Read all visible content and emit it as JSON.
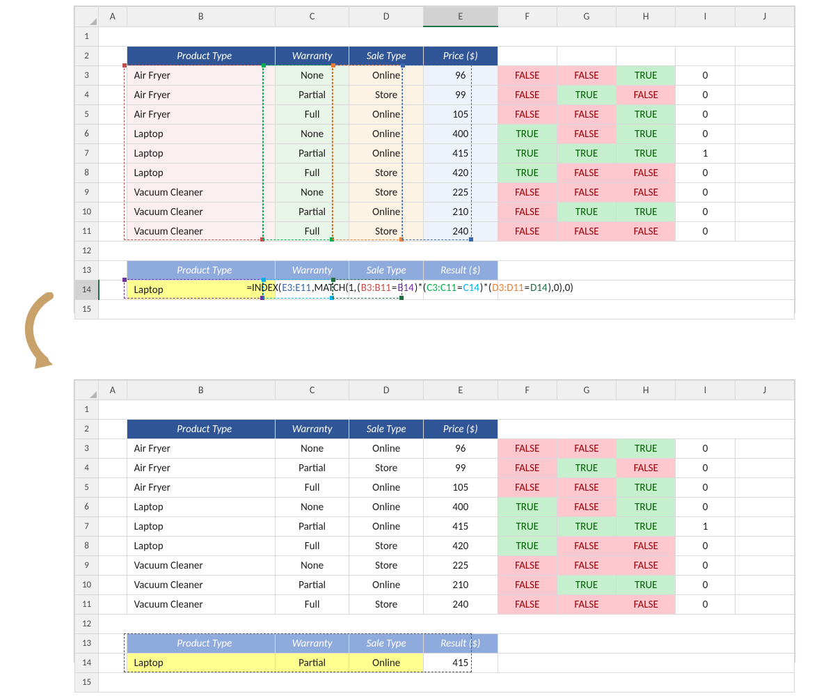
{
  "columns": [
    "A",
    "B",
    "C",
    "D",
    "E",
    "F",
    "G",
    "H",
    "I",
    "J"
  ],
  "rows": [
    1,
    2,
    3,
    4,
    5,
    6,
    7,
    8,
    9,
    10,
    11,
    12,
    13,
    14,
    15
  ],
  "headers_main": {
    "product_type": "Product Type",
    "warranty": "Warranty",
    "sale_type": "Sale Type",
    "price": "Price ($)"
  },
  "headers_lookup": {
    "product_type": "Product Type",
    "warranty": "Warranty",
    "sale_type": "Sale Type",
    "result": "Result ($)"
  },
  "rows_data": [
    {
      "b": "Air Fryer",
      "c": "None",
      "d": "Online",
      "e": "96",
      "f": "FALSE",
      "g": "FALSE",
      "h": "TRUE",
      "i": "0"
    },
    {
      "b": "Air Fryer",
      "c": "Partial",
      "d": "Store",
      "e": "99",
      "f": "FALSE",
      "g": "TRUE",
      "h": "FALSE",
      "i": "0"
    },
    {
      "b": "Air Fryer",
      "c": "Full",
      "d": "Online",
      "e": "105",
      "f": "FALSE",
      "g": "FALSE",
      "h": "TRUE",
      "i": "0"
    },
    {
      "b": "Laptop",
      "c": "None",
      "d": "Online",
      "e": "400",
      "f": "TRUE",
      "g": "FALSE",
      "h": "TRUE",
      "i": "0"
    },
    {
      "b": "Laptop",
      "c": "Partial",
      "d": "Online",
      "e": "415",
      "f": "TRUE",
      "g": "TRUE",
      "h": "TRUE",
      "i": "1"
    },
    {
      "b": "Laptop",
      "c": "Full",
      "d": "Store",
      "e": "420",
      "f": "TRUE",
      "g": "FALSE",
      "h": "FALSE",
      "i": "0"
    },
    {
      "b": "Vacuum Cleaner",
      "c": "None",
      "d": "Store",
      "e": "225",
      "f": "FALSE",
      "g": "FALSE",
      "h": "FALSE",
      "i": "0"
    },
    {
      "b": "Vacuum Cleaner",
      "c": "Partial",
      "d": "Online",
      "e": "210",
      "f": "FALSE",
      "g": "TRUE",
      "h": "TRUE",
      "i": "0"
    },
    {
      "b": "Vacuum Cleaner",
      "c": "Full",
      "d": "Store",
      "e": "240",
      "f": "FALSE",
      "g": "FALSE",
      "h": "FALSE",
      "i": "0"
    }
  ],
  "lookup_top": {
    "b": "Laptop",
    "formula_parts": {
      "p1": "=INDEX(",
      "p2": "E3:E11",
      "p3": ",MATCH(1,",
      "p4": "(",
      "p5": "B3:B11",
      "p6": "=",
      "p7": "B14",
      "p8": ")*(",
      "p9": "C3:C11",
      "p10": "=",
      "p11": "C14",
      "p12": ")*(",
      "p13": "D3:D11",
      "p14": "=",
      "p15": "D14",
      "p16": "),0),0)"
    }
  },
  "lookup_bottom": {
    "b": "Laptop",
    "c": "Partial",
    "d": "Online",
    "result": "415"
  },
  "colors": {
    "ref_E": "#3a66b0",
    "ref_B": "#c0504d",
    "ref_Brow": "#7030a0",
    "ref_C": "#00b050",
    "ref_Crow": "#00b0f0",
    "ref_D": "#ed7d31",
    "ref_Drow": "#1f6f43"
  }
}
